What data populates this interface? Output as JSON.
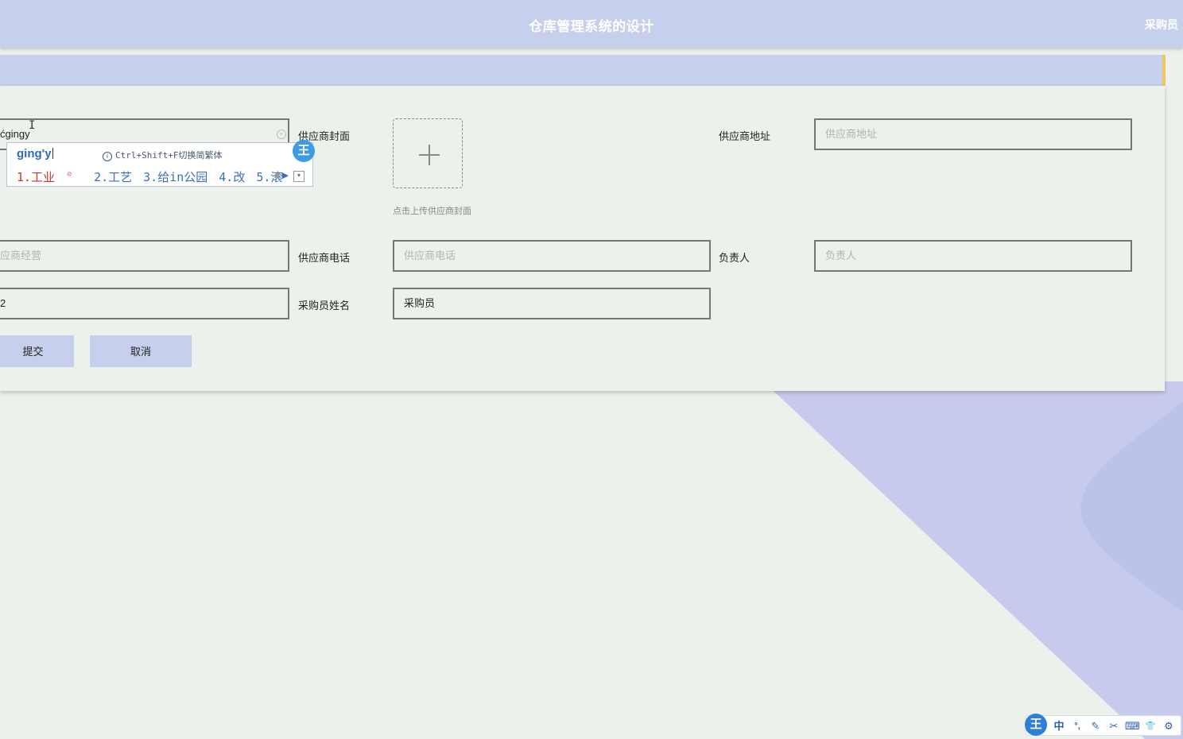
{
  "header": {
    "title": "仓库管理系统的设计",
    "role": "采购员"
  },
  "form": {
    "name_input_value": "ćgingy",
    "cover_label": "供应商封面",
    "cover_hint": "点击上传供应商封面",
    "address_label": "供应商地址",
    "address_placeholder": "供应商地址",
    "business_placeholder": "应商经营",
    "phone_label": "供应商电话",
    "phone_placeholder": "供应商电话",
    "contact_label": "负责人",
    "contact_placeholder": "负责人",
    "left_row3_value": "2",
    "buyer_label": "采购员姓名",
    "buyer_value": "采购员",
    "submit_label": "提交",
    "cancel_label": "取消"
  },
  "ime": {
    "pinyin": "ging'y",
    "hint": "Ctrl+Shift+F切换简繁体",
    "candidates": [
      "1.工业",
      "2.工艺",
      "3.给in公园",
      "4.改",
      "5.滚"
    ],
    "logo": "王"
  },
  "ime_toolbar": {
    "logo": "王",
    "items": [
      "中",
      "°,",
      "✎",
      "✂",
      "⌨",
      "👕",
      "⚙"
    ]
  },
  "colors": {
    "accent": "#c6cfec",
    "background": "#edf1ec",
    "crumb_edge": "#f0c75e",
    "ime_blue": "#3b9be3"
  }
}
